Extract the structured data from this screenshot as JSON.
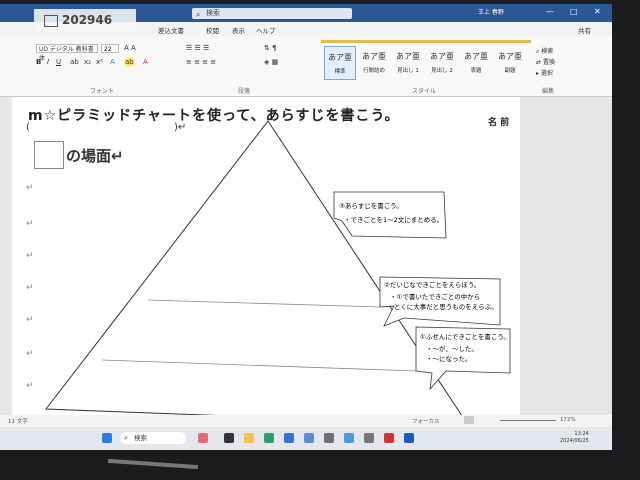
{
  "window": {
    "doc_title": "202946",
    "search_placeholder": "検索",
    "user_name": "王上 春野",
    "controls": [
      "—",
      "□",
      "✕"
    ]
  },
  "ribbon": {
    "tabs": [
      "差込文書",
      "校閲",
      "表示",
      "ヘルプ"
    ],
    "font_name": "UD デジタル 教科書体",
    "font_size": "22",
    "group_font": "フォント",
    "group_paragraph": "段落",
    "group_styles": "スタイル",
    "group_editing": "編集",
    "styles": [
      {
        "sample": "あア亜",
        "name": "標準"
      },
      {
        "sample": "あア亜",
        "name": "行間詰め"
      },
      {
        "sample": "あア亜",
        "name": "見出し 1"
      },
      {
        "sample": "あア亜",
        "name": "見出し 2"
      },
      {
        "sample": "あア亜",
        "name": "表題"
      },
      {
        "sample": "あア亜",
        "name": "副題"
      }
    ],
    "right_tools": [
      "検索",
      "置換",
      "選択"
    ],
    "share_label": "共有"
  },
  "document": {
    "heading": "m☆ピラミッドチャートを使って、あらすじを書こう。",
    "name_label": "名 前",
    "paren_left": "(",
    "paren_right": ")↵",
    "scene_label": "の場面↵",
    "return_mark": "↵",
    "callouts": [
      {
        "title": "③あらすじを書こう。",
        "lines": [
          "・できごとを1～2文にまとめる。"
        ]
      },
      {
        "title": "②だいじなできごとをえらぼう。",
        "lines": [
          "・①で書いたできごとの中から",
          "とくに大事だと思うものをえらぶ。"
        ]
      },
      {
        "title": "①ふせんにできごとを書こう。",
        "lines": [
          "・～が、～した。",
          "・～になった。"
        ]
      }
    ]
  },
  "statusbar": {
    "left": "11 文字",
    "right": "フォーカス",
    "zoom": "172%"
  },
  "taskbar": {
    "search_label": "検索",
    "time": "13:24",
    "date": "2024/06/25"
  }
}
